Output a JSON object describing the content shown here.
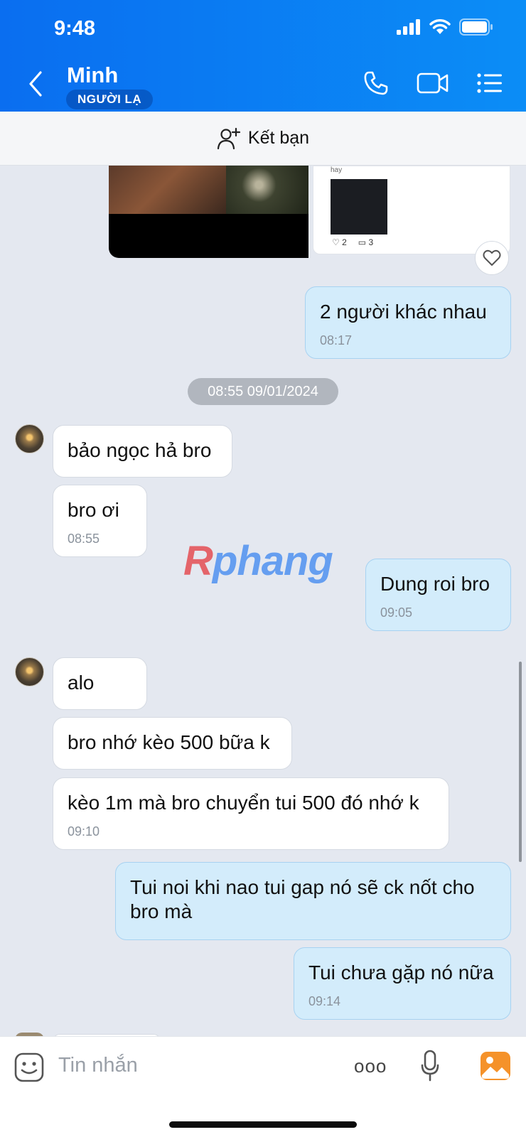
{
  "status_bar": {
    "time": "9:48"
  },
  "header": {
    "contact_name": "Minh",
    "badge": "NGƯỜI LẠ",
    "icons": [
      "back-chevron-icon",
      "phone-icon",
      "video-icon",
      "menu-list-icon"
    ]
  },
  "friend_bar": {
    "label": "Kết bạn",
    "icon": "add-friend-icon"
  },
  "top_media": {
    "post_caption": "hay",
    "likes": "2",
    "comments": "3",
    "menu_glyph": "..."
  },
  "date_separator": "08:55 09/01/2024",
  "watermark": {
    "part_r": "R",
    "rest": "phang"
  },
  "messages": [
    {
      "side": "out",
      "text": "2 người khác nhau",
      "time": "08:17"
    },
    {
      "side": "in",
      "text": "bảo ngọc hả bro"
    },
    {
      "side": "in",
      "text": "bro ơi",
      "time": "08:55"
    },
    {
      "side": "out",
      "text": "Dung roi bro",
      "time": "09:05"
    },
    {
      "side": "in",
      "text": "alo"
    },
    {
      "side": "in",
      "text": "bro nhớ kèo 500 bữa k"
    },
    {
      "side": "in",
      "text": "kèo 1m mà bro chuyển tui 500 đó nhớ k",
      "time": "09:10"
    },
    {
      "side": "out",
      "text": "Tui noi khi nao tui gap nó sẽ ck nốt cho bro mà"
    },
    {
      "side": "out",
      "text": "Tui chưa gặp nó nữa",
      "time": "09:14"
    }
  ],
  "input": {
    "placeholder": "Tin nhắn",
    "more_glyph": "ooo"
  }
}
